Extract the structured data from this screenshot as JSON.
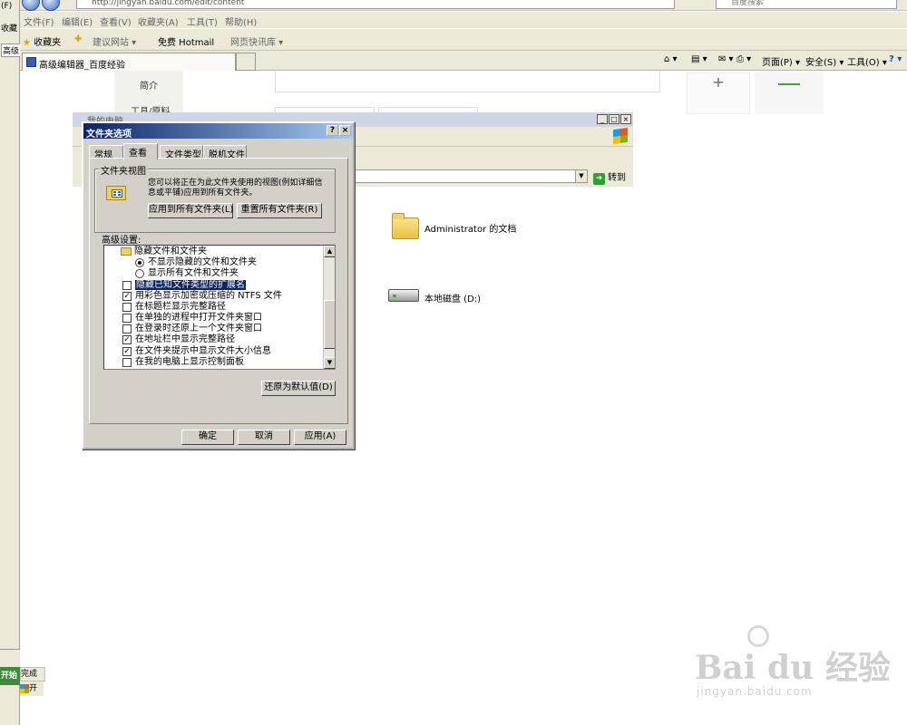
{
  "browser": {
    "url": "http://jingyan.baidu.com/edit/content",
    "search_placeholder": "百度搜索",
    "menu": [
      "文件(F)",
      "编辑(E)",
      "查看(V)",
      "收藏夹(A)",
      "工具(T)",
      "帮助(H)"
    ],
    "favorites_label": "收藏夹",
    "fav_links": [
      "建议网站 ▾",
      "免费 Hotmail",
      "网页快讯库 ▾"
    ],
    "tab_title": "高级编辑器_百度经验",
    "commands": [
      "页面(P) ▾",
      "安全(S) ▾",
      "工具(O) ▾"
    ]
  },
  "left_window": {
    "menu": "(F)",
    "fav": "收藏",
    "tab": "高级",
    "start": "开始",
    "status": "完成",
    "task": "开"
  },
  "page": {
    "side_nav": [
      "简介",
      "工具/原料"
    ]
  },
  "explorer": {
    "title": "我的电脑",
    "go_label": "转到",
    "items": [
      {
        "name": "Administrator 的文档",
        "icon": "folder-icon"
      },
      {
        "name": "本地磁盘 (D:)",
        "icon": "drive-icon"
      }
    ]
  },
  "dialog": {
    "title": "文件夹选项",
    "tabs": [
      "常规",
      "查看",
      "文件类型",
      "脱机文件"
    ],
    "active_tab": "查看",
    "group_title": "文件夹视图",
    "group_desc": "您可以将正在为此文件夹使用的视图(例如详细信息或平铺)应用到所有文件夹。",
    "apply_all": "应用到所有文件夹(L)",
    "reset_all": "重置所有文件夹(R)",
    "advanced_label": "高级设置:",
    "settings": [
      {
        "type": "folder",
        "label": "隐藏文件和文件夹"
      },
      {
        "type": "radio",
        "checked": true,
        "label": "不显示隐藏的文件和文件夹"
      },
      {
        "type": "radio",
        "checked": false,
        "label": "显示所有文件和文件夹"
      },
      {
        "type": "checkbox",
        "checked": false,
        "label": "隐藏已知文件类型的扩展名",
        "selected": true
      },
      {
        "type": "checkbox",
        "checked": true,
        "label": "用彩色显示加密或压缩的 NTFS 文件"
      },
      {
        "type": "checkbox",
        "checked": false,
        "label": "在标题栏显示完整路径"
      },
      {
        "type": "checkbox",
        "checked": false,
        "label": "在单独的进程中打开文件夹窗口"
      },
      {
        "type": "checkbox",
        "checked": false,
        "label": "在登录时还原上一个文件夹窗口"
      },
      {
        "type": "checkbox",
        "checked": true,
        "label": "在地址栏中显示完整路径"
      },
      {
        "type": "checkbox",
        "checked": true,
        "label": "在文件夹提示中显示文件大小信息"
      },
      {
        "type": "checkbox",
        "checked": false,
        "label": "在我的电脑上显示控制面板"
      }
    ],
    "restore_defaults": "还原为默认值(D)",
    "ok": "确定",
    "cancel": "取消",
    "apply": "应用(A)"
  },
  "watermark": {
    "brand": "Bai du 经验",
    "url": "jingyan.baidu.com"
  }
}
